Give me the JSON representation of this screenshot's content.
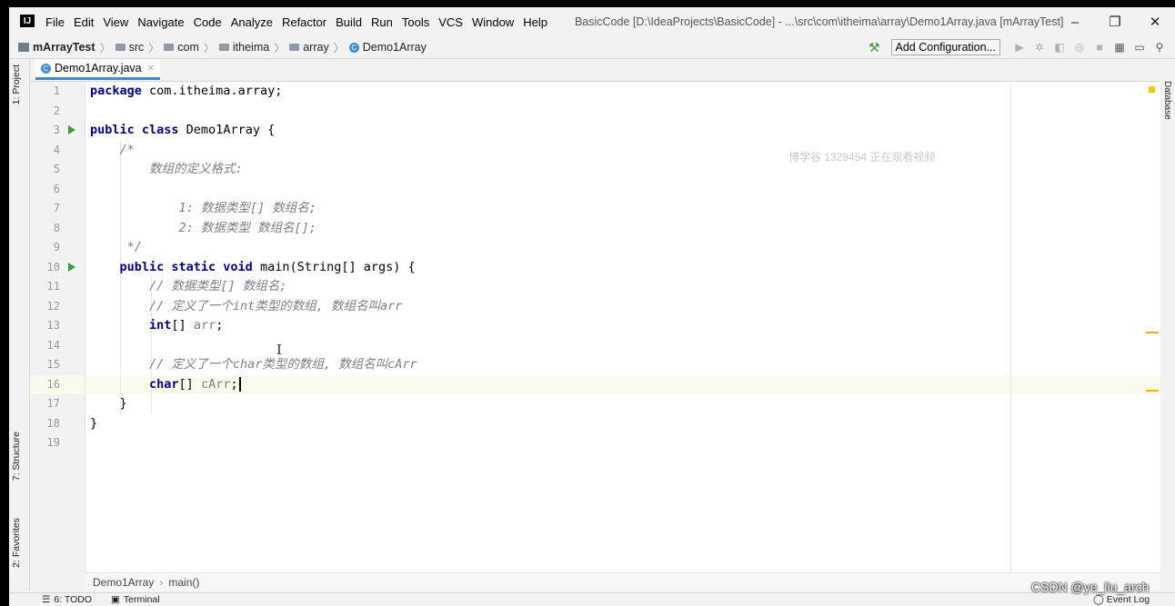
{
  "menu": {
    "items": [
      "File",
      "Edit",
      "View",
      "Navigate",
      "Code",
      "Analyze",
      "Refactor",
      "Build",
      "Run",
      "Tools",
      "VCS",
      "Window",
      "Help"
    ],
    "window_title": "BasicCode [D:\\IdeaProjects\\BasicCode] - ...\\src\\com\\itheima\\array\\Demo1Array.java [mArrayTest]"
  },
  "nav": {
    "crumbs": [
      "mArrayTest",
      "src",
      "com",
      "itheima",
      "array",
      "Demo1Array"
    ],
    "add_config": "Add Configuration..."
  },
  "side": {
    "project": "1: Project",
    "structure": "7: Structure",
    "favorites": "2: Favorites",
    "database": "Database"
  },
  "tab": {
    "label": "Demo1Array.java"
  },
  "editor": {
    "lines": [
      {
        "n": "1",
        "code": "package com.itheima.array;"
      },
      {
        "n": "2",
        "code": ""
      },
      {
        "n": "3",
        "code": "public class Demo1Array {"
      },
      {
        "n": "4",
        "code": "    /*"
      },
      {
        "n": "5",
        "code": "        数组的定义格式:"
      },
      {
        "n": "6",
        "code": ""
      },
      {
        "n": "7",
        "code": "            1: 数据类型[] 数组名;"
      },
      {
        "n": "8",
        "code": "            2: 数据类型 数组名[];"
      },
      {
        "n": "9",
        "code": "     */"
      },
      {
        "n": "10",
        "code": "    public static void main(String[] args) {"
      },
      {
        "n": "11",
        "code": "        // 数据类型[] 数组名;"
      },
      {
        "n": "12",
        "code": "        // 定义了一个int类型的数组, 数组名叫arr"
      },
      {
        "n": "13",
        "code": "        int[] arr;"
      },
      {
        "n": "14",
        "code": ""
      },
      {
        "n": "15",
        "code": "        // 定义了一个char类型的数组, 数组名叫cArr"
      },
      {
        "n": "16",
        "code": "        char[] cArr;"
      },
      {
        "n": "17",
        "code": "    }"
      },
      {
        "n": "18",
        "code": "}"
      },
      {
        "n": "19",
        "code": ""
      }
    ],
    "watermark": "博学谷 1329454 正在观看视频"
  },
  "breadcrumb": {
    "cls": "Demo1Array",
    "method": "main()"
  },
  "status": {
    "todo": "6: TODO",
    "terminal": "Terminal",
    "event_log": "Event Log"
  },
  "overlay": {
    "csdn": "CSDN @ye_liu_arch"
  },
  "colors": {
    "keyword": "#000080",
    "comment": "#808080",
    "run": "#389e3b",
    "warn": "#e6b800"
  }
}
